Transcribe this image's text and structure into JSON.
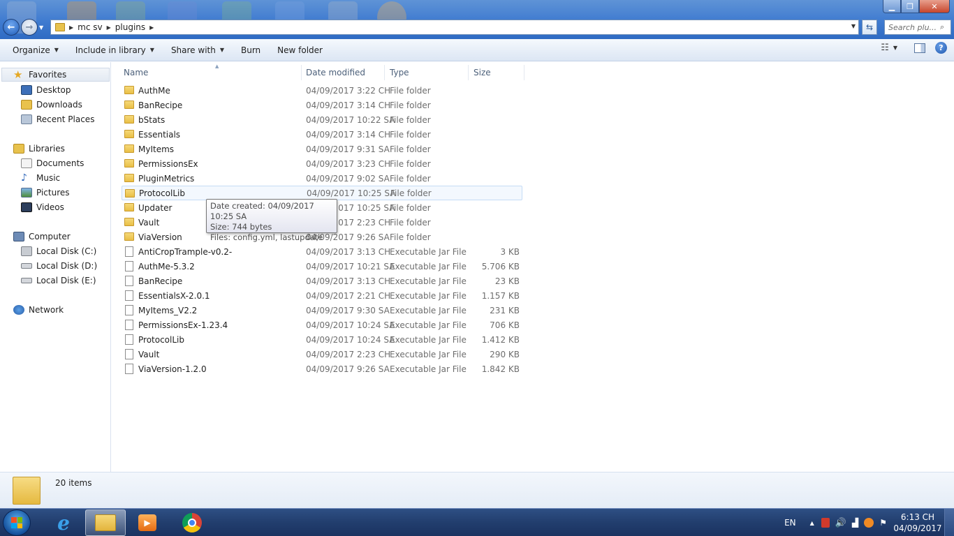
{
  "window": {
    "minimize_glyph": "▁",
    "maximize_glyph": "❐",
    "close_glyph": "✕"
  },
  "address": {
    "crumbs": [
      "mc sv",
      "plugins"
    ],
    "search_placeholder": "Search plu..."
  },
  "toolbar": {
    "organize": "Organize",
    "include_in_library": "Include in library",
    "share_with": "Share with",
    "burn": "Burn",
    "new_folder": "New folder"
  },
  "nav": {
    "favorites": "Favorites",
    "desktop": "Desktop",
    "downloads": "Downloads",
    "recent_places": "Recent Places",
    "libraries": "Libraries",
    "documents": "Documents",
    "music": "Music",
    "pictures": "Pictures",
    "videos": "Videos",
    "computer": "Computer",
    "local_c": "Local Disk (C:)",
    "local_d": "Local Disk (D:)",
    "local_e": "Local Disk (E:)",
    "network": "Network"
  },
  "columns": {
    "name": "Name",
    "date": "Date modified",
    "type": "Type",
    "size": "Size"
  },
  "files": [
    {
      "name": "AuthMe",
      "date": "04/09/2017 3:22 CH",
      "type": "File folder",
      "size": "",
      "kind": "folder"
    },
    {
      "name": "BanRecipe",
      "date": "04/09/2017 3:14 CH",
      "type": "File folder",
      "size": "",
      "kind": "folder"
    },
    {
      "name": "bStats",
      "date": "04/09/2017 10:22 SA",
      "type": "File folder",
      "size": "",
      "kind": "folder"
    },
    {
      "name": "Essentials",
      "date": "04/09/2017 3:14 CH",
      "type": "File folder",
      "size": "",
      "kind": "folder"
    },
    {
      "name": "MyItems",
      "date": "04/09/2017 9:31 SA",
      "type": "File folder",
      "size": "",
      "kind": "folder"
    },
    {
      "name": "PermissionsEx",
      "date": "04/09/2017 3:23 CH",
      "type": "File folder",
      "size": "",
      "kind": "folder"
    },
    {
      "name": "PluginMetrics",
      "date": "04/09/2017 9:02 SA",
      "type": "File folder",
      "size": "",
      "kind": "folder"
    },
    {
      "name": "ProtocolLib",
      "date": "04/09/2017 10:25 SA",
      "type": "File folder",
      "size": "",
      "kind": "folder"
    },
    {
      "name": "Updater",
      "date": "04/09/2017 10:25 SA",
      "type": "File folder",
      "size": "",
      "kind": "folder"
    },
    {
      "name": "Vault",
      "date": "04/09/2017 2:23 CH",
      "type": "File folder",
      "size": "",
      "kind": "folder"
    },
    {
      "name": "ViaVersion",
      "date": "04/09/2017 9:26 SA",
      "type": "File folder",
      "size": "",
      "kind": "folder"
    },
    {
      "name": "AntiCropTrample-v0.2-",
      "date": "04/09/2017 3:13 CH",
      "type": "Executable Jar File",
      "size": "3 KB",
      "kind": "jar"
    },
    {
      "name": "AuthMe-5.3.2",
      "date": "04/09/2017 10:21 SA",
      "type": "Executable Jar File",
      "size": "5.706 KB",
      "kind": "jar"
    },
    {
      "name": "BanRecipe",
      "date": "04/09/2017 3:13 CH",
      "type": "Executable Jar File",
      "size": "23 KB",
      "kind": "jar"
    },
    {
      "name": "EssentialsX-2.0.1",
      "date": "04/09/2017 2:21 CH",
      "type": "Executable Jar File",
      "size": "1.157 KB",
      "kind": "jar"
    },
    {
      "name": "MyItems_V2.2",
      "date": "04/09/2017 9:30 SA",
      "type": "Executable Jar File",
      "size": "231 KB",
      "kind": "jar"
    },
    {
      "name": "PermissionsEx-1.23.4",
      "date": "04/09/2017 10:24 SA",
      "type": "Executable Jar File",
      "size": "706 KB",
      "kind": "jar"
    },
    {
      "name": "ProtocolLib",
      "date": "04/09/2017 10:24 SA",
      "type": "Executable Jar File",
      "size": "1.412 KB",
      "kind": "jar"
    },
    {
      "name": "Vault",
      "date": "04/09/2017 2:23 CH",
      "type": "Executable Jar File",
      "size": "290 KB",
      "kind": "jar"
    },
    {
      "name": "ViaVersion-1.2.0",
      "date": "04/09/2017 9:26 SA",
      "type": "Executable Jar File",
      "size": "1.842 KB",
      "kind": "jar"
    }
  ],
  "hover_index": 7,
  "tooltip": {
    "line1": "Date created: 04/09/2017 10:25 SA",
    "line2": "Size: 744 bytes",
    "line3": "Files: config.yml, lastupdate"
  },
  "details": {
    "item_count": "20 items"
  },
  "taskbar": {
    "language": "EN",
    "time": "6:13 CH",
    "date": "04/09/2017"
  },
  "colors": {
    "folder": "#e9bf46",
    "accent": "#3f7bd0",
    "hover_row": "#f3f8fe"
  }
}
